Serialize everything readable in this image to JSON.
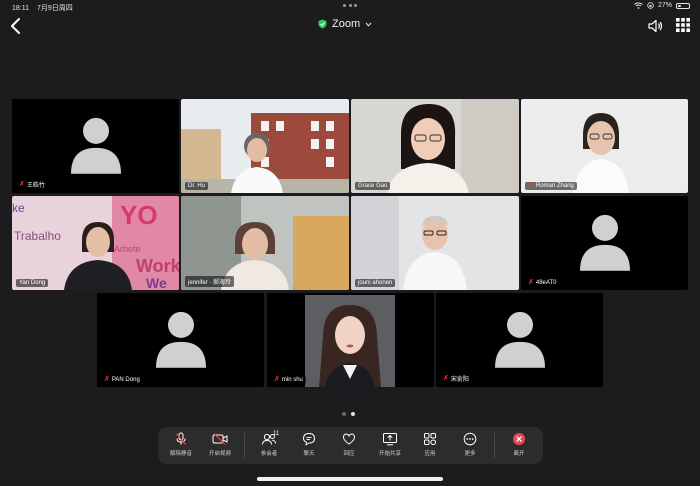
{
  "status_bar": {
    "time": "18:11",
    "date": "7月9日周四",
    "battery": "27%",
    "battery_level": 0.27
  },
  "header": {
    "title": "Zoom",
    "shield_color": "#2ecc55"
  },
  "participants": [
    {
      "name": "王皓竹",
      "muted": true,
      "video": false
    },
    {
      "name": "Dr. Hu",
      "muted": false,
      "video": true
    },
    {
      "name": "Grace Gao",
      "muted": false,
      "video": true
    },
    {
      "name": "Roman Zhang",
      "muted": true,
      "video": true
    },
    {
      "name": "Yan Dong",
      "muted": false,
      "video": true
    },
    {
      "name": "jennifer · 郝海玲",
      "muted": false,
      "video": true,
      "active_speaker": true
    },
    {
      "name": "jouni ahonen",
      "muted": false,
      "video": true
    },
    {
      "name": "48eAT0",
      "muted": true,
      "video": false
    },
    {
      "name": "PAN Dong",
      "muted": true,
      "video": false
    },
    {
      "name": "min shu",
      "muted": true,
      "video": true
    },
    {
      "name": "宋俞阳",
      "muted": true,
      "video": false
    }
  ],
  "poster_words": {
    "w1": "Trabalho",
    "w2": "Arbete",
    "w3": "Work",
    "w4": "We",
    "w5": "ke"
  },
  "pagination": {
    "total": 2,
    "current": 2
  },
  "toolbar": {
    "unmute": "解除静音",
    "start_video": "开启视频",
    "participants": "参会者",
    "participants_count": "11",
    "chat": "聊天",
    "react": "回应",
    "share": "开始共享",
    "apps": "应用",
    "more": "更多",
    "leave": "离开"
  },
  "colors": {
    "leave": "#e5484d",
    "active_speaker": "#2ecc55",
    "accent": "#ff3b30"
  }
}
